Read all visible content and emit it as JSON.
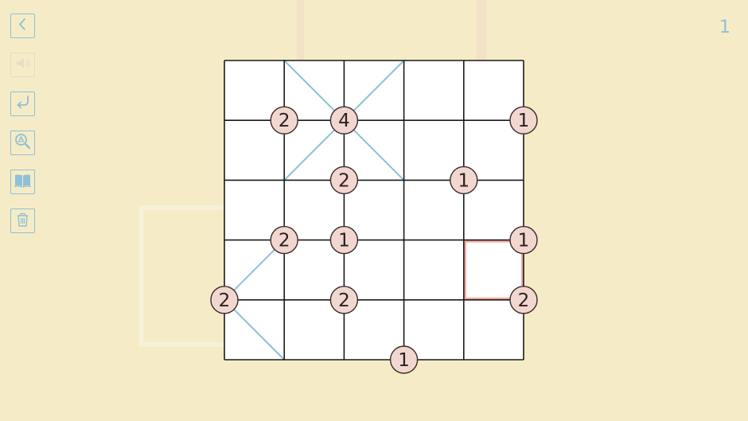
{
  "level": {
    "number": "1"
  },
  "toolbar": [
    {
      "name": "back-button",
      "icon": "chevron-left-icon",
      "enabled": true
    },
    {
      "name": "sound-button",
      "icon": "speaker-icon",
      "enabled": false
    },
    {
      "name": "undo-button",
      "icon": "undo-arrow-icon",
      "enabled": true
    },
    {
      "name": "hint-button",
      "icon": "magnifier-hint-icon",
      "enabled": true
    },
    {
      "name": "rules-button",
      "icon": "open-book-icon",
      "enabled": true
    },
    {
      "name": "clear-button",
      "icon": "trash-icon",
      "enabled": true
    }
  ],
  "colors": {
    "background": "#f5ecc7",
    "cell": "#ffffff",
    "grid_line": "#1a1a1a",
    "slash": "#8fc0d6",
    "clue_fill": "#f2d6d0",
    "clue_stroke": "#3a2a2a",
    "selection": "#f2a8a0",
    "icon": "#8fc0d6"
  },
  "puzzle": {
    "type": "Gokigen Naname (slant)",
    "rows": 5,
    "cols": 5,
    "clues": [
      {
        "r": 1,
        "c": 1,
        "value": "2"
      },
      {
        "r": 1,
        "c": 2,
        "value": "4"
      },
      {
        "r": 1,
        "c": 5,
        "value": "1"
      },
      {
        "r": 2,
        "c": 2,
        "value": "2"
      },
      {
        "r": 2,
        "c": 4,
        "value": "1"
      },
      {
        "r": 3,
        "c": 1,
        "value": "2"
      },
      {
        "r": 3,
        "c": 2,
        "value": "1"
      },
      {
        "r": 3,
        "c": 5,
        "value": "1"
      },
      {
        "r": 4,
        "c": 0,
        "value": "2"
      },
      {
        "r": 4,
        "c": 2,
        "value": "2"
      },
      {
        "r": 4,
        "c": 5,
        "value": "2"
      },
      {
        "r": 5,
        "c": 3,
        "value": "1"
      }
    ],
    "slashes": [
      {
        "r": 0,
        "c": 1,
        "dir": "\\"
      },
      {
        "r": 0,
        "c": 2,
        "dir": "/"
      },
      {
        "r": 1,
        "c": 1,
        "dir": "/"
      },
      {
        "r": 1,
        "c": 2,
        "dir": "\\"
      },
      {
        "r": 3,
        "c": 0,
        "dir": "/"
      },
      {
        "r": 4,
        "c": 0,
        "dir": "\\"
      }
    ],
    "selected_cell": {
      "r": 3,
      "c": 4
    }
  }
}
